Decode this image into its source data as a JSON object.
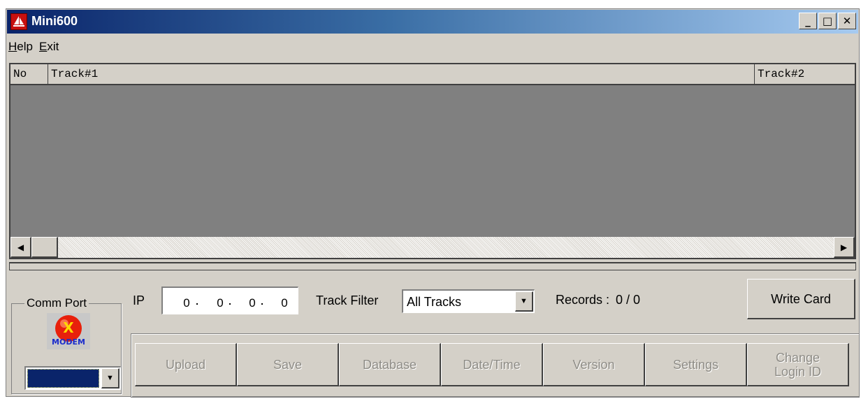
{
  "window": {
    "title": "Mini600",
    "minimize": "_",
    "maximize": "□",
    "close": "✕"
  },
  "menu": {
    "help": "Help",
    "exit": "Exit"
  },
  "grid": {
    "columns": [
      "No",
      "Track#1",
      "Track#2"
    ]
  },
  "comm_port": {
    "label": "Comm Port",
    "modem_icon": "x-modem-icon",
    "modem_text": "MODEM",
    "selected": ""
  },
  "ip": {
    "label": "IP",
    "octets": [
      "0",
      "0",
      "0",
      "0"
    ]
  },
  "track_filter": {
    "label": "Track Filter",
    "selected": "All Tracks"
  },
  "records": {
    "label": "Records :",
    "value": "0 / 0"
  },
  "buttons": {
    "write_card": "Write Card",
    "upload": "Upload",
    "save": "Save",
    "database": "Database",
    "date_time": "Date/Time",
    "version": "Version",
    "settings": "Settings",
    "change_login": "Change\nLogin ID"
  },
  "colors": {
    "title_start": "#0a246a",
    "title_end": "#a6caf0",
    "face": "#d4d0c8",
    "grid_bg": "#808080",
    "selection": "#0a246a"
  }
}
